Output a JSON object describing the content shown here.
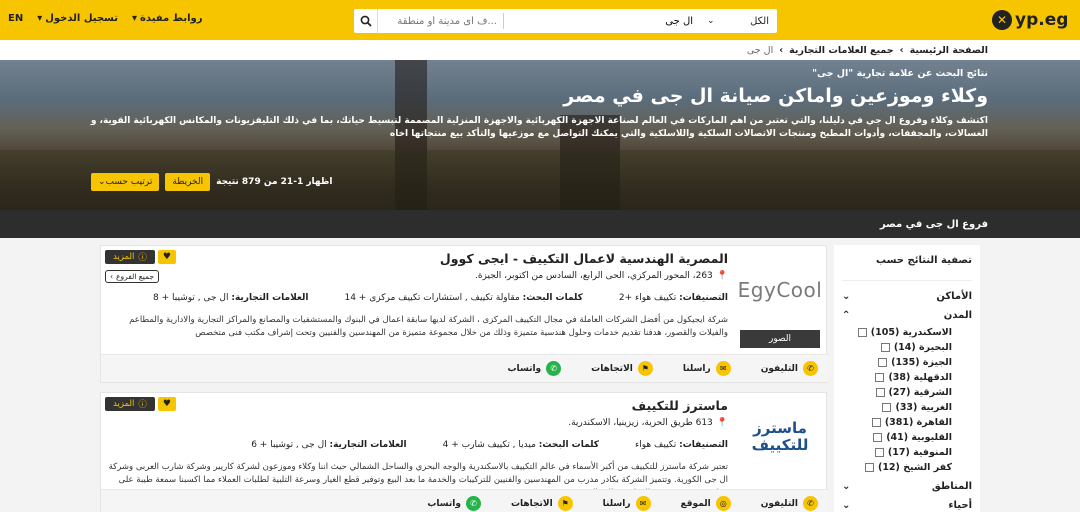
{
  "header": {
    "logo_text": "yp.eg",
    "search_category": "الكل",
    "search_query": "ال جى",
    "search_location_placeholder": "...ف أى مدينة أو منطقة",
    "nav_lang": "EN",
    "nav_login": "تسجيل الدخول",
    "nav_links": "روابط مفيدة"
  },
  "breadcrumb": {
    "home": "الصفحة الرئيسية",
    "brands": "جميع العلامات التجارية",
    "current": "ال جى"
  },
  "hero": {
    "results_prefix": "نتائج البحث عن",
    "results_term": "علامة تجارية \"ال جى\"",
    "title": "وكلاء وموزعين واماكن صيانة ال جى في مصر",
    "description": "اكتشف وكلاء وفروع ال جي في دليلنا، والتي تعتبر من اهم الماركات في العالم لصناعة الاجهزة الكهربائية والاجهزة المنزلية المصممة لتبسيط حياتك، بما في ذلك التليفزيونات والمكانس الكهربائية القوية، و الغسالات، والمجففات، وأدوات المطبخ ومنتجات الاتصالات السلكية واللاسلكية والتي يمكنك التواصل مع موزعيها والتأكد بيع منتجاتها اخاه",
    "count": "اظهار 1-21 من 879 نتيجة",
    "map_button": "الخريطة",
    "sort_button": "ترتيب حسب"
  },
  "band": {
    "label": "فروع ال جى في مصر"
  },
  "sidebar": {
    "title": "تصفية النتائج حسب",
    "places": "الأماكن",
    "cities": "المدن",
    "city_items": [
      "الاسكندرية (105)",
      "البحيرة (14)",
      "الجيزة (135)",
      "الدقهلية (38)",
      "الشرقية (27)",
      "الغربية (33)",
      "القاهرة (381)",
      "القليوبية (41)",
      "المنوفية (17)",
      "كفر الشيخ (12)"
    ],
    "areas": "المناطق",
    "districts": "أحياء"
  },
  "listings": [
    {
      "logo_text": "EgyCool",
      "photos": "الصور",
      "name": "المصرية الهندسية لاعمال التكييف - ايجى كوول",
      "address": "263، المحور المركزي، الحى الرابع، السادس من اكتوبر، الجيزة.",
      "categories_label": "التصنيفات:",
      "categories": "تكييف هواء +2",
      "keywords_label": "كلمات البحث:",
      "keywords": "مقاولة تكييف , استشارات تكييف مركزى + 14",
      "brands_label": "العلامات التجارية:",
      "brands": "ال جى , توشيبا + 8",
      "description": "شركة ايجيكول من أفضل الشركات العاملة في مجال التكييف المركزى ، الشركة لديها سابقة اعمال في البنوك والمستشفيات والمصانع والمراكز التجارية والادارية والمطاعم والفيلات والقصور، هدفنا تقديم خدمات وحلول هندسية متميزة وذلك من خلال مجموعة متميزة من المهندسين والفنيين وتحت إشراف مكتب فنى متخصص",
      "more": "المزيد",
      "branches": "جميع الفروع",
      "actions": [
        "التليفون",
        "راسلنا",
        "الاتجاهات",
        "واتساب"
      ]
    },
    {
      "logo_text": "ماسترز للتكييف",
      "name": "ماسترز للتكييف",
      "address": "613 طريق الحرية، زيزينيا، الاسكندرية.",
      "categories_label": "التصنيفات:",
      "categories": "تكييف هواء",
      "keywords_label": "كلمات البحث:",
      "keywords": "ميديا , تكييف شارب + 4",
      "brands_label": "العلامات التجارية:",
      "brands": "ال جى , توشيبا + 6",
      "description": "تعتبر شركة ماسترز للتكييف من أكبر الأسماء في عالم التكييف بالاسكندرية والوجه البحري والساحل الشمالي حيث اننا وكلاء وموزعون لشركة كاريير وشركة شارب العربى وشركة ال جى الكورية. وتتميز الشركة بكادر مدرب من المهندسين والفنيين للتركيبات والخدمة ما بعد البيع وتوفير قطع الغيار وسرعة التلبية لطلبات العملاء مما اكسبنا سمعة طيبة على مدار عشرين سنة من العمل في المجال",
      "more": "المزيد",
      "actions": [
        "التليفون",
        "الموقع",
        "راسلنا",
        "الاتجاهات",
        "واتساب"
      ]
    }
  ]
}
